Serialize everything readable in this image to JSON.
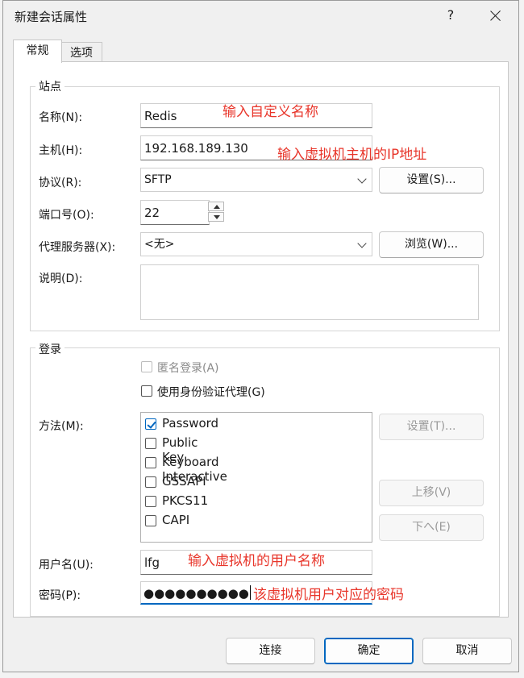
{
  "window": {
    "title": "新建会话属性",
    "help_label": "?"
  },
  "tabs": [
    {
      "label": "常规"
    },
    {
      "label": "选项"
    }
  ],
  "site": {
    "legend": "站点",
    "name_label": "名称(N):",
    "name_value": "Redis",
    "host_label": "主机(H):",
    "host_value": "192.168.189.130",
    "protocol_label": "协议(R):",
    "protocol_value": "SFTP",
    "protocol_settings_label": "设置(S)...",
    "port_label": "端口号(O):",
    "port_value": "22",
    "proxy_label": "代理服务器(X):",
    "proxy_value": "<无>",
    "proxy_browse_label": "浏览(W)...",
    "description_label": "说明(D):",
    "description_value": ""
  },
  "login": {
    "legend": "登录",
    "anonymous_label": "匿名登录(A)",
    "agent_label": "使用身份验证代理(G)",
    "method_label": "方法(M):",
    "methods": [
      {
        "label": "Password",
        "checked": true
      },
      {
        "label": "Public Key",
        "checked": false
      },
      {
        "label": "Keyboard Interactive",
        "checked": false
      },
      {
        "label": "GSSAPI",
        "checked": false
      },
      {
        "label": "PKCS11",
        "checked": false
      },
      {
        "label": "CAPI",
        "checked": false
      }
    ],
    "method_settings_label": "设置(T)...",
    "move_up_label": "上移(V)",
    "move_down_label": "下へ(E)",
    "username_label": "用户名(U):",
    "username_value": "lfg",
    "password_label": "密码(P):",
    "password_value": "●●●●●●●●●●"
  },
  "annotations": {
    "name_note": "输入自定义名称",
    "host_note": "输入虚拟机主机的IP地址",
    "user_note": "输入虚拟机的用户名称",
    "password_note": "该虚拟机用户对应的密码"
  },
  "footer": {
    "connect_label": "连接",
    "ok_label": "确定",
    "cancel_label": "取消"
  },
  "colors": {
    "annotation": "#e8362b",
    "accent": "#0067c0"
  }
}
